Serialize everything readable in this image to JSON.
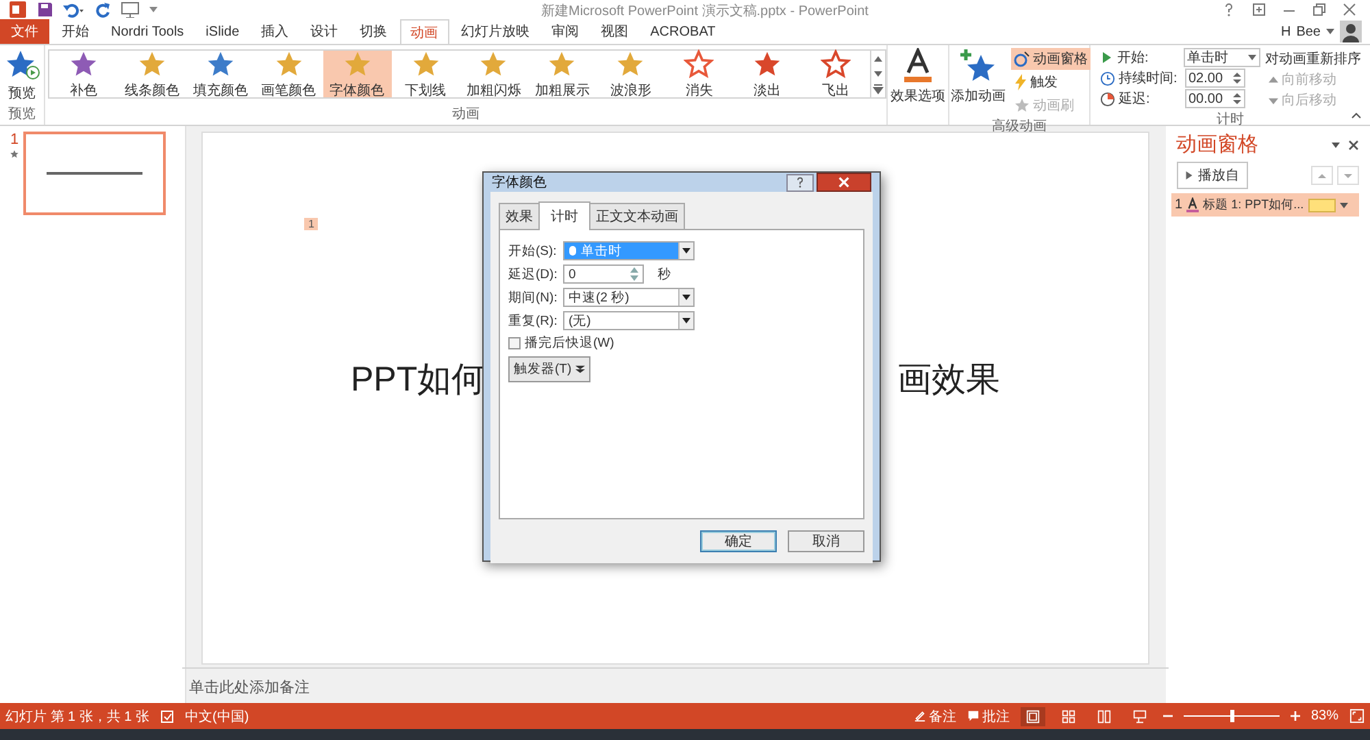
{
  "app": {
    "title": "新建Microsoft PowerPoint 演示文稿.pptx - PowerPoint",
    "user_initial": "H",
    "user_name": "Bee"
  },
  "file_tab": "文件",
  "ribbon_tabs": [
    {
      "label": "开始",
      "selected": false
    },
    {
      "label": "Nordri Tools",
      "selected": false
    },
    {
      "label": "iSlide",
      "selected": false
    },
    {
      "label": "插入",
      "selected": false
    },
    {
      "label": "设计",
      "selected": false
    },
    {
      "label": "切换",
      "selected": false
    },
    {
      "label": "动画",
      "selected": true
    },
    {
      "label": "幻灯片放映",
      "selected": false
    },
    {
      "label": "审阅",
      "selected": false
    },
    {
      "label": "视图",
      "selected": false
    },
    {
      "label": "ACROBAT",
      "selected": false
    }
  ],
  "preview": {
    "label": "预览",
    "group": "预览"
  },
  "animations": {
    "group": "动画",
    "items": [
      {
        "label": "补色",
        "color": "#8e5bb5",
        "kind": "solid",
        "selected": false
      },
      {
        "label": "线条颜色",
        "color": "#e2a93b",
        "kind": "solid",
        "selected": false
      },
      {
        "label": "填充颜色",
        "color": "#3d7cc9",
        "kind": "solid",
        "selected": false
      },
      {
        "label": "画笔颜色",
        "color": "#e2a93b",
        "kind": "solid",
        "selected": false
      },
      {
        "label": "字体颜色",
        "color": "#e2a93b",
        "kind": "solid",
        "selected": true
      },
      {
        "label": "下划线",
        "color": "#e2a93b",
        "kind": "solid",
        "selected": false
      },
      {
        "label": "加粗闪烁",
        "color": "#e2a93b",
        "kind": "solid",
        "selected": false
      },
      {
        "label": "加粗展示",
        "color": "#e2a93b",
        "kind": "solid",
        "selected": false
      },
      {
        "label": "波浪形",
        "color": "#e2a93b",
        "kind": "solid",
        "selected": false
      },
      {
        "label": "消失",
        "color": "#e8583a",
        "kind": "outline",
        "selected": false
      },
      {
        "label": "淡出",
        "color": "#d9472b",
        "kind": "solid",
        "selected": false
      },
      {
        "label": "飞出",
        "color": "#d9472b",
        "kind": "outline",
        "selected": false
      }
    ]
  },
  "effect_options": "效果选项",
  "advanced": {
    "group": "高级动画",
    "add": "添加动画",
    "pane": {
      "label": "动画窗格",
      "selected": true
    },
    "trigger": "触发",
    "painter": {
      "label": "动画刷",
      "disabled": true
    }
  },
  "timing": {
    "group": "计时",
    "start_label": "开始:",
    "start_value": "单击时",
    "duration_label": "持续时间:",
    "duration_value": "02.00",
    "delay_label": "延迟:",
    "delay_value": "00.00",
    "reorder": "对动画重新排序",
    "forward": {
      "label": "向前移动",
      "disabled": true
    },
    "backward": {
      "label": "向后移动",
      "disabled": true
    }
  },
  "thumbnails": [
    {
      "number": "1",
      "selected": true
    }
  ],
  "slide": {
    "title_parts": [
      "PPT如何",
      "画效果"
    ],
    "marker": "1"
  },
  "notes_placeholder": "单击此处添加备注",
  "animation_pane": {
    "title": "动画窗格",
    "play": "播放自",
    "items": [
      {
        "index": "1",
        "label": "标题 1: PPT如何...",
        "color": "#ffe07a",
        "selected": true
      }
    ]
  },
  "dialog": {
    "title": "字体颜色",
    "tabs": [
      {
        "label": "效果",
        "selected": false
      },
      {
        "label": "计时",
        "selected": true
      },
      {
        "label": "正文文本动画",
        "selected": false
      }
    ],
    "fields": [
      {
        "kind": "dropdown",
        "label": "开始(S):",
        "value": "单击时",
        "highlighted": true
      },
      {
        "kind": "spinner",
        "label": "延迟(D):",
        "value": "0",
        "unit": "秒"
      },
      {
        "kind": "dropdown",
        "label": "期间(N):",
        "value": "中速(2 秒)",
        "highlighted": false
      },
      {
        "kind": "dropdown",
        "label": "重复(R):",
        "value": "(无)",
        "highlighted": false
      }
    ],
    "rewind": {
      "label": "播完后快退(W)",
      "checked": false
    },
    "triggers": "触发器(T)",
    "ok": "确定",
    "cancel": "取消"
  },
  "status_bar": {
    "slide_info": "幻灯片 第 1 张，共 1 张",
    "language": "中文(中国)",
    "notes": "备注",
    "comments": "批注",
    "views": [
      {
        "selected": true
      },
      {
        "selected": false
      },
      {
        "selected": false
      },
      {
        "selected": false
      }
    ],
    "zoom": {
      "level": 0.5,
      "reading": "83%"
    }
  }
}
